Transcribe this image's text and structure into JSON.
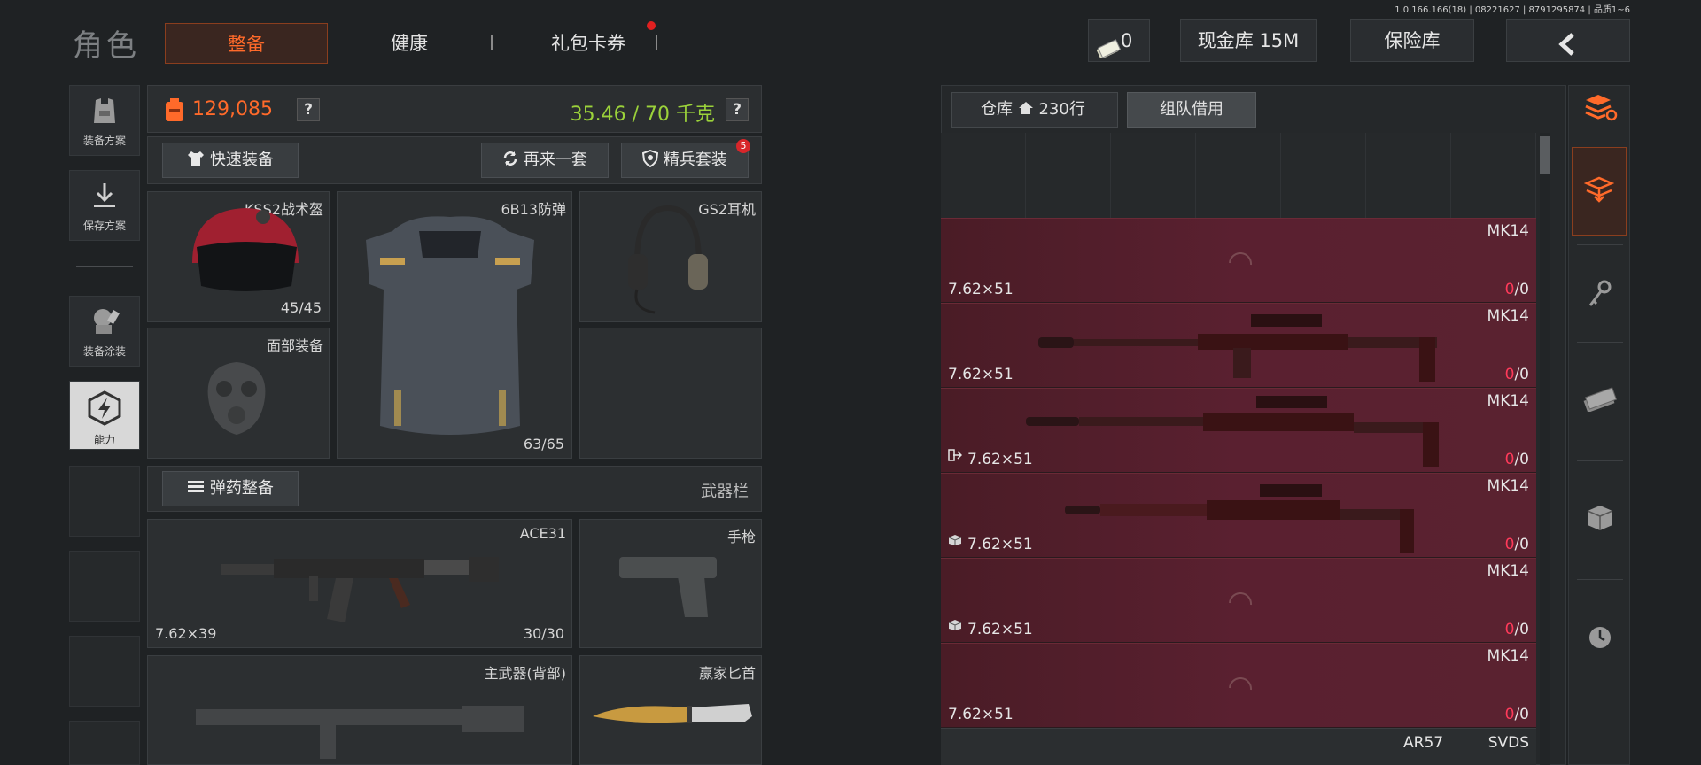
{
  "version": "1.0.166.166(18) | 08221627 | 8791295874 | 品质1~6",
  "header": {
    "title": "角色",
    "tabs": [
      {
        "label": "整备",
        "active": true
      },
      {
        "label": "健康",
        "active": false
      },
      {
        "label": "礼包卡券",
        "active": false,
        "notification": true
      }
    ],
    "cash_count": "0",
    "cash_vault": "现金库 15M",
    "safe_box": "保险库"
  },
  "sidebar": {
    "items": [
      {
        "label": "装备方案",
        "icon": "vest-icon"
      },
      {
        "label": "保存方案",
        "icon": "download-icon"
      },
      {
        "label": "装备涂装",
        "icon": "paint-icon"
      },
      {
        "label": "能力",
        "icon": "ability-icon",
        "active": true
      }
    ]
  },
  "stats": {
    "money": "129,085",
    "weight": "35.46 / 70 千克",
    "help": "?"
  },
  "actions": {
    "quick_equip": "快速装备",
    "redo": "再来一套",
    "elite_set": "精兵套装",
    "elite_badge": "5"
  },
  "gear": {
    "helmet": {
      "name": "KSS2战术盔",
      "durability": "45/45"
    },
    "armor": {
      "name": "6B13防弹",
      "durability": "63/65"
    },
    "headset": {
      "name": "GS2耳机"
    },
    "face": {
      "name": "面部装备"
    }
  },
  "ammo_bar": {
    "button": "弹药整备",
    "label": "武器栏"
  },
  "weapons": {
    "primary": {
      "name": "ACE31",
      "caliber": "7.62×39",
      "ammo": "30/30"
    },
    "pistol": {
      "name": "手枪"
    },
    "backpack_primary": {
      "name": "主武器(背部)"
    },
    "knife": {
      "name": "赢家匕首"
    }
  },
  "warehouse": {
    "tab_label": "仓库",
    "rows": "230行",
    "team_borrow": "组队借用",
    "items": [
      {
        "name": "MK14",
        "caliber": "7.62×51",
        "ammo_cur": "0",
        "ammo_max": "/0",
        "icon": "none",
        "loaded": false
      },
      {
        "name": "MK14",
        "caliber": "7.62×51",
        "ammo_cur": "0",
        "ammo_max": "/0",
        "icon": "none",
        "loaded": true
      },
      {
        "name": "MK14",
        "caliber": "7.62×51",
        "ammo_cur": "0",
        "ammo_max": "/0",
        "icon": "exit",
        "loaded": true
      },
      {
        "name": "MK14",
        "caliber": "7.62×51",
        "ammo_cur": "0",
        "ammo_max": "/0",
        "icon": "box",
        "loaded": true
      },
      {
        "name": "MK14",
        "caliber": "7.62×51",
        "ammo_cur": "0",
        "ammo_max": "/0",
        "icon": "box",
        "loaded": false
      },
      {
        "name": "MK14",
        "caliber": "7.62×51",
        "ammo_cur": "0",
        "ammo_max": "/0",
        "icon": "none",
        "loaded": false
      }
    ],
    "footer_names": [
      "AR57",
      "SVDS"
    ]
  },
  "colors": {
    "accent": "#ff6a2a",
    "money": "#ff6a2a",
    "weight": "#9bd23a",
    "ammo_empty": "#ff3a5a",
    "cell": "#5a2030"
  }
}
